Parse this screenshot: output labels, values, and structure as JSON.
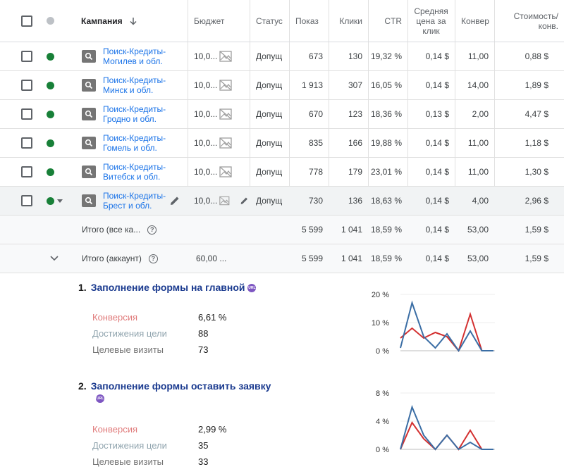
{
  "table": {
    "headers": {
      "campaign": "Кампания",
      "budget": "Бюджет",
      "status": "Статус",
      "impressions": "Показ",
      "clicks": "Клики",
      "ctr": "CTR",
      "avg_cpc": "Средняя цена за клик",
      "conversions": "Конвер",
      "cost_per_conv": "Стоимость/ конв."
    },
    "rows": [
      {
        "campaign": "Поиск-Кредиты-Могилев и обл.",
        "budget": "10,0...",
        "status": "Допущ",
        "impressions": "673",
        "clicks": "130",
        "ctr": "19,32 %",
        "avg_cpc": "0,14 $",
        "conversions": "11,00",
        "cost_per_conv": "0,88 $"
      },
      {
        "campaign": "Поиск-Кредиты-Минск и обл.",
        "budget": "10,0...",
        "status": "Допущ",
        "impressions": "1 913",
        "clicks": "307",
        "ctr": "16,05 %",
        "avg_cpc": "0,14 $",
        "conversions": "14,00",
        "cost_per_conv": "1,89 $"
      },
      {
        "campaign": "Поиск-Кредиты-Гродно и обл.",
        "budget": "10,0...",
        "status": "Допущ",
        "impressions": "670",
        "clicks": "123",
        "ctr": "18,36 %",
        "avg_cpc": "0,13 $",
        "conversions": "2,00",
        "cost_per_conv": "4,47 $"
      },
      {
        "campaign": "Поиск-Кредиты-Гомель и обл.",
        "budget": "10,0...",
        "status": "Допущ",
        "impressions": "835",
        "clicks": "166",
        "ctr": "19,88 %",
        "avg_cpc": "0,14 $",
        "conversions": "11,00",
        "cost_per_conv": "1,18 $"
      },
      {
        "campaign": "Поиск-Кредиты-Витебск и обл.",
        "budget": "10,0...",
        "status": "Допущ",
        "impressions": "778",
        "clicks": "179",
        "ctr": "23,01 %",
        "avg_cpc": "0,14 $",
        "conversions": "11,00",
        "cost_per_conv": "1,30 $"
      },
      {
        "campaign": "Поиск-Кредиты-Брест и обл.",
        "budget": "10,0...",
        "status": "Допущ",
        "impressions": "730",
        "clicks": "136",
        "ctr": "18,63 %",
        "avg_cpc": "0,14 $",
        "conversions": "4,00",
        "cost_per_conv": "2,96 $"
      }
    ],
    "totals": [
      {
        "label": "Итого (все ка...",
        "budget": "",
        "impressions": "5 599",
        "clicks": "1 041",
        "ctr": "18,59 %",
        "avg_cpc": "0,14 $",
        "conversions": "53,00",
        "cost_per_conv": "1,59 $"
      },
      {
        "label": "Итого (аккаунт)",
        "budget": "60,00 ...",
        "impressions": "5 599",
        "clicks": "1 041",
        "ctr": "18,59 %",
        "avg_cpc": "0,14 $",
        "conversions": "53,00",
        "cost_per_conv": "1,59 $"
      }
    ],
    "icons": {
      "sort": "arrow-down-icon",
      "campaign_type": "search-icon",
      "budget": "image-placeholder-icon",
      "edit": "pencil-icon",
      "help": "help-circle-icon",
      "expand": "chevron-down-icon"
    },
    "colors": {
      "link": "#1a73e8",
      "status_enabled": "#188038"
    }
  },
  "goals": [
    {
      "number": "1.",
      "title": "Заполнение формы на главной",
      "badge": "URL",
      "metrics": [
        {
          "label": "Конверсия",
          "value": "6,61 %"
        },
        {
          "label": "Достижения цели",
          "value": "88"
        },
        {
          "label": "Целевые визиты",
          "value": "73"
        }
      ]
    },
    {
      "number": "2.",
      "title": "Заполнение формы оставить заявку",
      "badge": "URL",
      "metrics": [
        {
          "label": "Конверсия",
          "value": "2,99 %"
        },
        {
          "label": "Достижения цели",
          "value": "35"
        },
        {
          "label": "Целевые визиты",
          "value": "33"
        }
      ]
    }
  ],
  "chart_data": [
    {
      "type": "line",
      "ylim": [
        0,
        20
      ],
      "y_ticks": [
        "0 %",
        "10 %",
        "20 %"
      ],
      "x": [
        1,
        2,
        3,
        4,
        5,
        6,
        7,
        8,
        9
      ],
      "series": [
        {
          "color": "#d32f2f",
          "values": [
            4.5,
            8,
            4.5,
            6.5,
            5,
            0,
            13,
            0,
            0
          ]
        },
        {
          "color": "#3b6ea5",
          "values": [
            1,
            17,
            5,
            1,
            6,
            0,
            7,
            0,
            0
          ]
        }
      ]
    },
    {
      "type": "line",
      "ylim": [
        0,
        8
      ],
      "y_ticks": [
        "0 %",
        "4 %",
        "8 %"
      ],
      "x": [
        1,
        2,
        3,
        4,
        5,
        6,
        7,
        8,
        9
      ],
      "series": [
        {
          "color": "#d32f2f",
          "values": [
            0,
            3.8,
            1.5,
            0,
            2,
            0,
            2.7,
            0,
            0
          ]
        },
        {
          "color": "#3b6ea5",
          "values": [
            0,
            6,
            2,
            0,
            2,
            0,
            1,
            0,
            0
          ]
        }
      ]
    }
  ]
}
